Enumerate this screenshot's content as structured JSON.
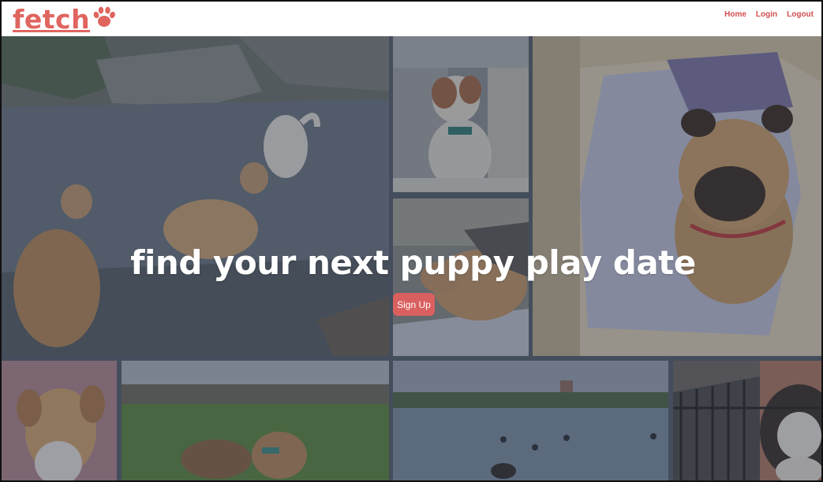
{
  "brand": {
    "name": "fetch",
    "icon": "paw-icon",
    "color": "#e0655f"
  },
  "nav": {
    "links": [
      "Home",
      "Login",
      "Logout"
    ],
    "color": "#d24f4f"
  },
  "hero": {
    "headline": "find your next puppy play date",
    "signup_label": "Sign Up",
    "signup_color": "#da5f5f",
    "photos": [
      "dogs-playing-in-creek-photo",
      "dog-in-car-photo",
      "pug-on-blanket-photo",
      "dog-on-couch-photo",
      "small-dog-portrait-photo",
      "dogs-in-park-photo",
      "lake-with-ducks-photo",
      "fluffy-dog-behind-gate-photo"
    ]
  }
}
